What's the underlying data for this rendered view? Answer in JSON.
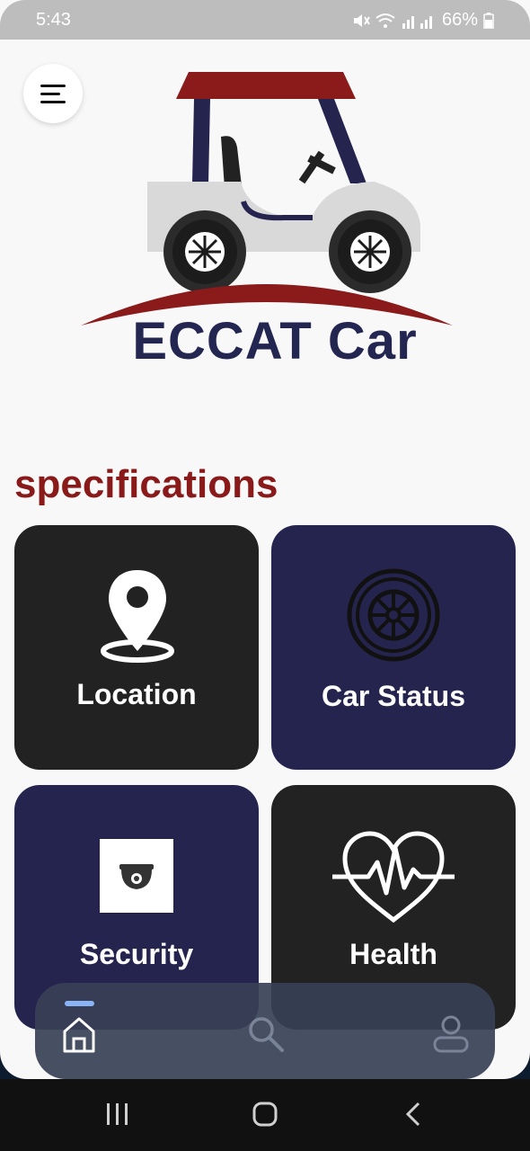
{
  "status_bar": {
    "time": "5:43",
    "battery": "66%"
  },
  "logo": {
    "text": "ECCAT Car"
  },
  "section": {
    "title": "specifications"
  },
  "cards": [
    {
      "label": "Location",
      "icon": "location-pin-icon",
      "bg": "#222222"
    },
    {
      "label": "Car Status",
      "icon": "tire-icon",
      "bg": "#25244e"
    },
    {
      "label": "Security",
      "icon": "security-camera-icon",
      "bg": "#25244e"
    },
    {
      "label": "Health",
      "icon": "heartbeat-icon",
      "bg": "#222222"
    }
  ],
  "bottom_nav": {
    "items": [
      "home-icon",
      "search-icon",
      "profile-icon"
    ],
    "active": "home-icon",
    "accent": "#8ab4f8"
  },
  "colors": {
    "title_red": "#8a1a1a",
    "navy": "#232650"
  }
}
